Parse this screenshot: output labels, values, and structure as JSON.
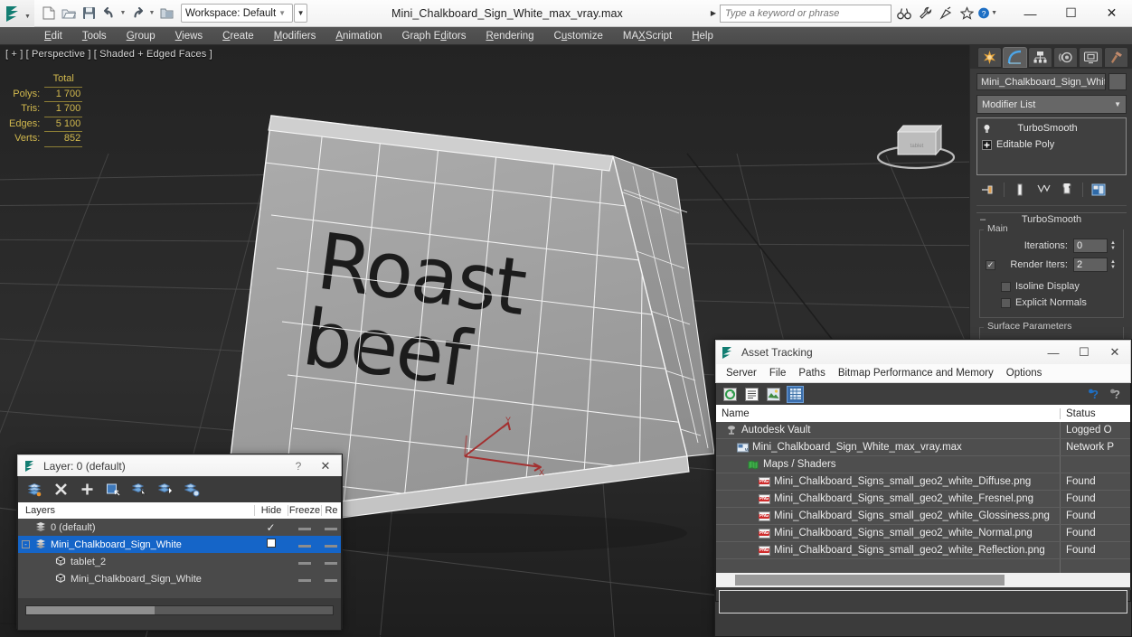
{
  "titlebar": {
    "window_title": "Mini_Chalkboard_Sign_White_max_vray.max",
    "workspace_label": "Workspace: Default",
    "search_placeholder": "Type a keyword or phrase",
    "minimize": "—",
    "maximize": "☐",
    "close": "✕",
    "quick_access": [
      {
        "name": "new-file-icon",
        "label": "New"
      },
      {
        "name": "open-file-icon",
        "label": "Open"
      },
      {
        "name": "save-file-icon",
        "label": "Save"
      },
      {
        "name": "undo-icon",
        "label": "Undo"
      },
      {
        "name": "redo-icon",
        "label": "Redo"
      },
      {
        "name": "project-folder-icon",
        "label": "Set Project Folder"
      }
    ],
    "search_icons": [
      {
        "name": "binoculars-icon"
      },
      {
        "name": "wrench-icon"
      },
      {
        "name": "satellite-icon"
      },
      {
        "name": "star-icon"
      },
      {
        "name": "help-icon"
      }
    ]
  },
  "menubar": {
    "items": [
      {
        "label": "Edit",
        "accel": "E"
      },
      {
        "label": "Tools",
        "accel": "T"
      },
      {
        "label": "Group",
        "accel": "G"
      },
      {
        "label": "Views",
        "accel": "V"
      },
      {
        "label": "Create",
        "accel": "C"
      },
      {
        "label": "Modifiers",
        "accel": "M"
      },
      {
        "label": "Animation",
        "accel": "A"
      },
      {
        "label": "Graph Editors",
        "accel": "d"
      },
      {
        "label": "Rendering",
        "accel": "R"
      },
      {
        "label": "Customize",
        "accel": "u"
      },
      {
        "label": "MAXScript",
        "accel": "X"
      },
      {
        "label": "Help",
        "accel": "H"
      }
    ]
  },
  "viewport": {
    "label": "[ + ] [ Perspective ] [ Shaded + Edged Faces ]",
    "stats": {
      "header": "Total",
      "rows": [
        {
          "label": "Polys:",
          "value": "1 700"
        },
        {
          "label": "Tris:",
          "value": "1 700"
        },
        {
          "label": "Edges:",
          "value": "5 100"
        },
        {
          "label": "Verts:",
          "value": "852"
        }
      ]
    },
    "sign_text_line1": "Roast",
    "sign_text_line2": "beef",
    "stats_color": "#d2b94e",
    "background_color": "#2c2c2c",
    "mesh_color": "#9e9e9e"
  },
  "command_panel": {
    "tabs": [
      {
        "name": "create-tab",
        "icon": "star-burst-icon",
        "active": false
      },
      {
        "name": "modify-tab",
        "icon": "bent-arc-icon",
        "active": true
      },
      {
        "name": "hierarchy-tab",
        "icon": "hierarchy-icon",
        "active": false
      },
      {
        "name": "motion-tab",
        "icon": "motion-wheel-icon",
        "active": false
      },
      {
        "name": "display-tab",
        "icon": "display-monitor-icon",
        "active": false
      },
      {
        "name": "utilities-tab",
        "icon": "hammer-icon",
        "active": false
      }
    ],
    "object_name": "Mini_Chalkboard_Sign_Whit",
    "modifier_list_label": "Modifier List",
    "stack": [
      {
        "label": "TurboSmooth",
        "icon": "lightbulb-icon"
      },
      {
        "label": "Editable Poly",
        "icon": "plus-box-icon"
      }
    ],
    "stack_tools": [
      {
        "name": "pin-stack-icon"
      },
      {
        "name": "show-end-result-icon"
      },
      {
        "name": "make-unique-icon"
      },
      {
        "name": "remove-modifier-icon"
      },
      {
        "name": "configure-modifier-sets-icon"
      }
    ],
    "rollout": {
      "title": "TurboSmooth",
      "collapse_glyph": "–",
      "group_title": "Main",
      "iterations_label": "Iterations:",
      "iterations_value": "0",
      "render_iters_label": "Render Iters:",
      "render_iters_value": "2",
      "render_iters_checked": true,
      "isoline_label": "Isoline Display",
      "isoline_checked": false,
      "explicit_normals_label": "Explicit Normals",
      "explicit_normals_checked": false,
      "surface_params_title": "Surface Parameters"
    }
  },
  "layer_dialog": {
    "title": "Layer: 0 (default)",
    "help_glyph": "?",
    "close_glyph": "✕",
    "toolbar": [
      {
        "name": "new-layer-icon"
      },
      {
        "name": "delete-layer-icon"
      },
      {
        "name": "add-layer-icon"
      },
      {
        "name": "select-objects-in-layer-icon"
      },
      {
        "name": "select-highlighted-objects-icon"
      },
      {
        "name": "add-selected-objects-icon"
      },
      {
        "name": "set-current-layer-icon"
      }
    ],
    "columns": {
      "name": "Layers",
      "hide": "Hide",
      "freeze": "Freeze",
      "render": "Re"
    },
    "rows": [
      {
        "name": "0 (default)",
        "indent": 0,
        "selected": false,
        "expandable": false,
        "icon": "layer-icon",
        "hide": "check",
        "freeze": "dash",
        "render": "dash"
      },
      {
        "name": "Mini_Chalkboard_Sign_White",
        "indent": 0,
        "selected": true,
        "expandable": true,
        "icon": "layer-icon",
        "hide": "box",
        "freeze": "dash",
        "render": "dash"
      },
      {
        "name": "tablet_2",
        "indent": 1,
        "selected": false,
        "expandable": false,
        "icon": "object-icon",
        "hide": "",
        "freeze": "dash",
        "render": "dash"
      },
      {
        "name": "Mini_Chalkboard_Sign_White",
        "indent": 1,
        "selected": false,
        "expandable": false,
        "icon": "object-icon",
        "hide": "",
        "freeze": "dash",
        "render": "dash"
      }
    ]
  },
  "asset_dialog": {
    "title": "Asset Tracking",
    "minimize": "—",
    "maximize": "☐",
    "close": "✕",
    "menu": [
      "Server",
      "File",
      "Paths",
      "Bitmap Performance and Memory",
      "Options"
    ],
    "toolbar": [
      {
        "name": "refresh-icon",
        "active": false
      },
      {
        "name": "list-view-icon",
        "active": false
      },
      {
        "name": "thumbnail-view-icon",
        "active": false
      },
      {
        "name": "grid-view-icon",
        "active": true
      }
    ],
    "right_toolbar": [
      {
        "name": "help-blue-icon"
      },
      {
        "name": "help-gray-icon"
      }
    ],
    "columns": {
      "name": "Name",
      "status": "Status"
    },
    "rows": [
      {
        "name": "Autodesk Vault",
        "status": "Logged O",
        "indent": 1,
        "icon": "vault-icon"
      },
      {
        "name": "Mini_Chalkboard_Sign_White_max_vray.max",
        "status": "Network P",
        "indent": 2,
        "icon": "max-file-icon"
      },
      {
        "name": "Maps / Shaders",
        "status": "",
        "indent": 3,
        "icon": "maps-icon"
      },
      {
        "name": "Mini_Chalkboard_Signs_small_geo2_white_Diffuse.png",
        "status": "Found",
        "indent": 4,
        "icon": "png-icon"
      },
      {
        "name": "Mini_Chalkboard_Signs_small_geo2_white_Fresnel.png",
        "status": "Found",
        "indent": 4,
        "icon": "png-icon"
      },
      {
        "name": "Mini_Chalkboard_Signs_small_geo2_white_Glossiness.png",
        "status": "Found",
        "indent": 4,
        "icon": "png-icon"
      },
      {
        "name": "Mini_Chalkboard_Signs_small_geo2_white_Normal.png",
        "status": "Found",
        "indent": 4,
        "icon": "png-icon"
      },
      {
        "name": "Mini_Chalkboard_Signs_small_geo2_white_Reflection.png",
        "status": "Found",
        "indent": 4,
        "icon": "png-icon"
      }
    ]
  }
}
